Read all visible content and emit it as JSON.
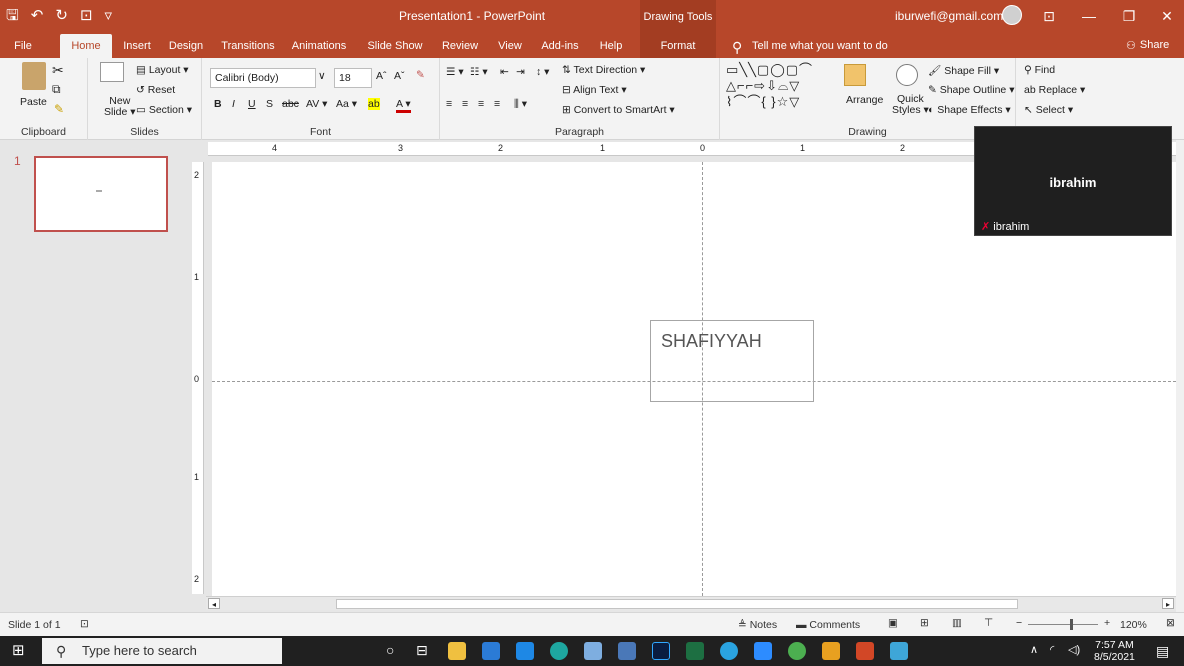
{
  "titlebar": {
    "title": "Presentation1  -  PowerPoint",
    "context_tools": "Drawing Tools",
    "account": "iburwefi@gmail.com",
    "accent": "#b7472a"
  },
  "tabs": [
    "File",
    "Home",
    "Insert",
    "Design",
    "Transitions",
    "Animations",
    "Slide Show",
    "Review",
    "View",
    "Add-ins",
    "Help",
    "Format"
  ],
  "tell_me": "Tell me what you want to do",
  "share": "Share",
  "ribbon": {
    "clipboard": {
      "paste": "Paste",
      "label": "Clipboard"
    },
    "slides": {
      "new_slide": "New",
      "new_slide2": "Slide",
      "layout": "Layout",
      "reset": "Reset",
      "section": "Section",
      "label": "Slides"
    },
    "font": {
      "name": "Calibri (Body)",
      "size": "18",
      "label": "Font"
    },
    "paragraph": {
      "text_direction": "Text Direction",
      "align_text": "Align Text",
      "convert": "Convert to SmartArt",
      "label": "Paragraph"
    },
    "drawing": {
      "arrange": "Arrange",
      "quick": "Quick",
      "styles": "Styles",
      "shape_fill": "Shape Fill",
      "shape_outline": "Shape Outline",
      "shape_effects": "Shape Effects",
      "label": "Drawing"
    },
    "editing": {
      "find": "Find",
      "replace": "Replace",
      "select": "Select"
    }
  },
  "ruler": {
    "h_labels": [
      "4",
      "3",
      "2",
      "1",
      "0",
      "1",
      "2"
    ],
    "v_labels": [
      "2",
      "1",
      "0",
      "1",
      "2"
    ]
  },
  "thumbnail": {
    "number": "1"
  },
  "slide": {
    "textbox": "SHAFIYYAH"
  },
  "zoom_overlay": {
    "name": "ibrahim",
    "tag": "ibrahim"
  },
  "status": {
    "slide": "Slide 1 of 1",
    "notes": "Notes",
    "comments": "Comments",
    "zoom": "120%"
  },
  "taskbar": {
    "search": "Type here to search",
    "time": "7:57 AM",
    "date": "8/5/2021"
  }
}
